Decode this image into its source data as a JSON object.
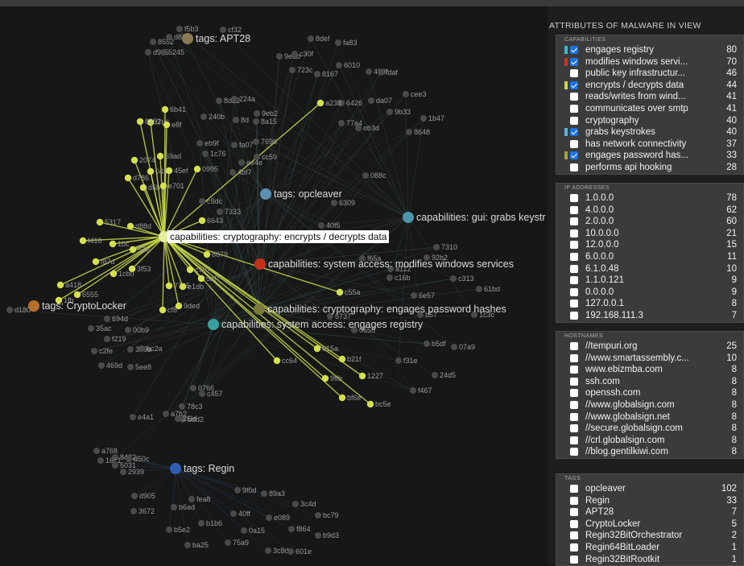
{
  "panel": {
    "title": "ATTRIBUTES OF MALWARE IN VIEW",
    "sections": [
      {
        "heading": "CAPABILITIES",
        "rows": [
          {
            "label": "engages registry",
            "count": "80",
            "checked": true,
            "bar": "#3fb8c9"
          },
          {
            "label": "modifies windows servi...",
            "count": "70",
            "checked": true,
            "bar": "#c2361c"
          },
          {
            "label": "public key infrastructur...",
            "count": "46",
            "checked": false,
            "bar": ""
          },
          {
            "label": "encrypts / decrypts data",
            "count": "44",
            "checked": true,
            "bar": "#c9d848"
          },
          {
            "label": "reads/writes from wind...",
            "count": "41",
            "checked": false,
            "bar": ""
          },
          {
            "label": "communicates over smtp",
            "count": "41",
            "checked": false,
            "bar": ""
          },
          {
            "label": "cryptography",
            "count": "40",
            "checked": false,
            "bar": ""
          },
          {
            "label": "grabs keystrokes",
            "count": "40",
            "checked": true,
            "bar": "#5ab4d6"
          },
          {
            "label": "has network connectivity",
            "count": "37",
            "checked": false,
            "bar": ""
          },
          {
            "label": "engages password has...",
            "count": "33",
            "checked": true,
            "bar": "#9aa83c"
          },
          {
            "label": "performs api hooking",
            "count": "28",
            "checked": false,
            "bar": ""
          }
        ]
      },
      {
        "heading": "IP ADDRESSES",
        "rows": [
          {
            "label": "1.0.0.0",
            "count": "78"
          },
          {
            "label": "4.0.0.0",
            "count": "62"
          },
          {
            "label": "2.0.0.0",
            "count": "60"
          },
          {
            "label": "10.0.0.0",
            "count": "21"
          },
          {
            "label": "12.0.0.0",
            "count": "15"
          },
          {
            "label": "6.0.0.0",
            "count": "11"
          },
          {
            "label": "6.1.0.48",
            "count": "10"
          },
          {
            "label": "1.1.0.121",
            "count": "9"
          },
          {
            "label": "0.0.0.0",
            "count": "9"
          },
          {
            "label": "127.0.0.1",
            "count": "8"
          },
          {
            "label": "192.168.111.3",
            "count": "7"
          }
        ]
      },
      {
        "heading": "HOSTNAMES",
        "rows": [
          {
            "label": "//tempuri.org",
            "count": "25"
          },
          {
            "label": "//www.smartassembly.c...",
            "count": "10"
          },
          {
            "label": "www.ebizmba.com",
            "count": "8"
          },
          {
            "label": "ssh.com",
            "count": "8"
          },
          {
            "label": "openssh.com",
            "count": "8"
          },
          {
            "label": "//www.globalsign.com",
            "count": "8"
          },
          {
            "label": "//www.globalsign.net",
            "count": "8"
          },
          {
            "label": "//secure.globalsign.com",
            "count": "8"
          },
          {
            "label": "//crl.globalsign.com",
            "count": "8"
          },
          {
            "label": "//blog.gentilkiwi.com",
            "count": "8"
          }
        ]
      },
      {
        "heading": "TAGS",
        "rows": [
          {
            "label": "opcleaver",
            "count": "102"
          },
          {
            "label": "Regin",
            "count": "33"
          },
          {
            "label": "APT28",
            "count": "7"
          },
          {
            "label": "CryptoLocker",
            "count": "5"
          },
          {
            "label": "Regin32BitOrchestrator",
            "count": "2"
          },
          {
            "label": "Regin64BitLoader",
            "count": "1"
          },
          {
            "label": "Regin32BitRootkit",
            "count": "1"
          }
        ]
      }
    ]
  },
  "graph": {
    "selected_label": "capabilities: cryptography: encrypts / decrypts data",
    "hubs": [
      {
        "label": "tags: APT28",
        "color": "#8a7a55"
      },
      {
        "label": "tags: opcleaver",
        "color": "#5a8fb0"
      },
      {
        "label": "capabilities: gui: grabs keystr",
        "color": "#4d93ad"
      },
      {
        "label": "capabilities: system access: modifies windows services",
        "color": "#c4321c"
      },
      {
        "label": "capabilities: cryptography: engages password hashes",
        "color": "#7a7d3a"
      },
      {
        "label": "capabilities: system access: engages registry",
        "color": "#3a9f9f"
      },
      {
        "label": "tags: CryptoLocker",
        "color": "#b86f2a"
      },
      {
        "label": "tags: Regin",
        "color": "#2f5fb0"
      }
    ],
    "yellow_nodes": [
      "6b41",
      "f7b6",
      "8252",
      "e8f",
      "2074",
      "69ad",
      "d786",
      "045f",
      "45ef",
      "d5b",
      "e701",
      "0995",
      "a238",
      "5317",
      "d88d",
      "f418",
      "1bc",
      "53e",
      "f87d",
      "3f53",
      "1cb0",
      "a418",
      "6555",
      "1fb",
      "7795",
      "cf8",
      "9ded",
      "e1db",
      "5af7",
      "c707",
      "8679",
      "6643",
      "c55a",
      "e15a",
      "b21f",
      "1227",
      "cc64",
      "9ffb",
      "bf6e",
      "bc5e"
    ],
    "gray_nodes": [
      "f5b3",
      "cf32",
      "8552",
      "d87b",
      "d9c5",
      "5245",
      "8def",
      "fa83",
      "9edb",
      "c30f",
      "6010",
      "403f",
      "723c",
      "8167",
      "fdaf",
      "da07",
      "cee3",
      "6426",
      "8d22",
      "224a",
      "240b",
      "8d",
      "9eb2",
      "8a15",
      "77a4",
      "9b33",
      "1b47",
      "ob3d",
      "8648",
      "eb9f",
      "fa07",
      "7696",
      "1c76",
      "cc59",
      "ee4e",
      "4bf7",
      "088c",
      "c9dc",
      "7333",
      "6309",
      "40f5",
      "7051",
      "7310",
      "92b2",
      "f65a",
      "a112",
      "c16b",
      "6e57",
      "c313",
      "61bd",
      "b57",
      "1c3c",
      "6737",
      "0655",
      "b5df",
      "07a9",
      "f31e",
      "24d5",
      "f467",
      "d180",
      "694d",
      "35ac",
      "00b9",
      "f219",
      "c2fe",
      "3b9a",
      "bc2a",
      "469d",
      "5ee8",
      "0766",
      "c457",
      "78c3",
      "a7b2",
      "bdd2",
      "2f3d",
      "e4a1",
      "a768",
      "8482",
      "16c1",
      "d50c",
      "5031",
      "2939",
      "d905",
      "9f0d",
      "89a3",
      "fea8",
      "3672",
      "b6ad",
      "40ff",
      "3c4d",
      "e089",
      "bc79",
      "b5e2",
      "b1b6",
      "0a15",
      "f864",
      "b9d3",
      "ba25",
      "75a9",
      "3c8d",
      "601e",
      "7322"
    ]
  }
}
